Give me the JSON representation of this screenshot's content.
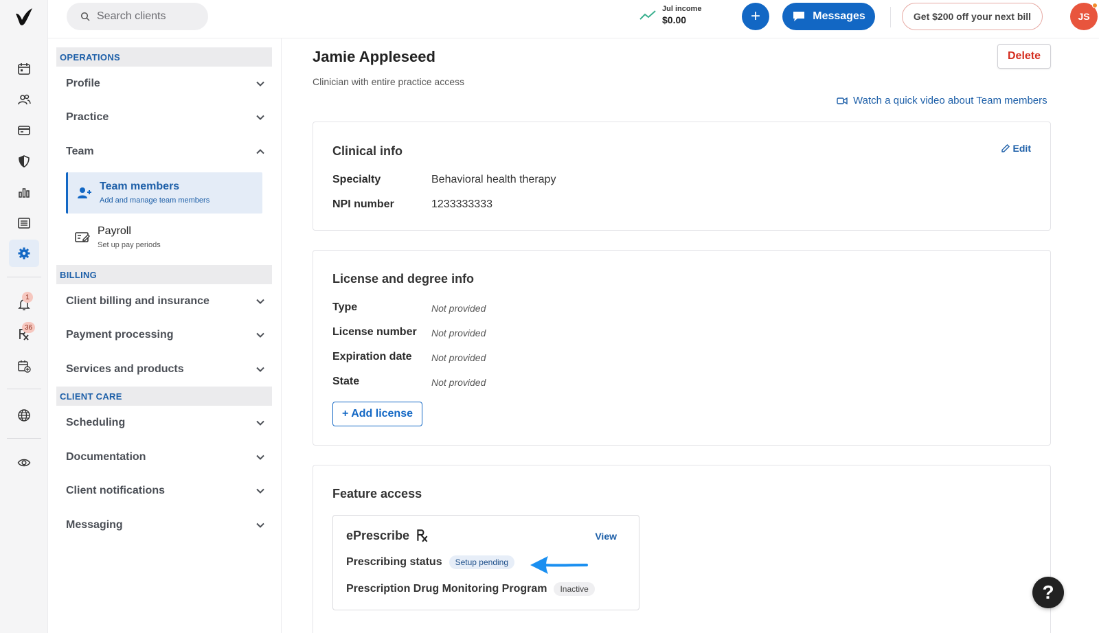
{
  "topbar": {
    "search_placeholder": "Search clients",
    "income_label": "Jul income",
    "income_value": "$0.00",
    "plus_label": "+",
    "messages_label": "Messages",
    "promo_label": "Get $200 off your next bill",
    "avatar_initials": "JS"
  },
  "rail": {
    "icons": [
      "logo",
      "calendar-icon",
      "clients-icon",
      "billing-card-icon",
      "insurance-shield-icon",
      "analytics-icon",
      "list-icon",
      "settings-gear-icon",
      "notifications-bell-icon",
      "prescription-icon",
      "calendar-add-icon",
      "globe-icon",
      "eye-icon"
    ],
    "notifications_badge": "1",
    "prescriptions_badge": "36",
    "accent": "#1267c4"
  },
  "sidebar": {
    "operations_header": "OPERATIONS",
    "profile": "Profile",
    "practice": "Practice",
    "team": "Team",
    "team_members": "Team members",
    "team_members_desc": "Add and manage team members",
    "payroll": "Payroll",
    "payroll_desc": "Set up pay periods",
    "billing_header": "BILLING",
    "client_billing": "Client billing and insurance",
    "payment_processing": "Payment processing",
    "services_products": "Services and products",
    "client_care_header": "CLIENT CARE",
    "scheduling": "Scheduling",
    "documentation": "Documentation",
    "client_notifications": "Client notifications",
    "messaging": "Messaging"
  },
  "main": {
    "title": "Jamie Appleseed",
    "subtitle": "Clinician with entire practice access",
    "delete_label": "Delete",
    "video_link": "Watch a quick video about Team members",
    "clinical": {
      "title": "Clinical info",
      "edit_label": "Edit",
      "specialty_label": "Specialty",
      "specialty_value": "Behavioral health therapy",
      "npi_label": "NPI number",
      "npi_value": "1233333333"
    },
    "license": {
      "title": "License and degree info",
      "type_label": "Type",
      "type_value": "Not provided",
      "number_label": "License number",
      "number_value": "Not provided",
      "expiration_label": "Expiration date",
      "expiration_value": "Not provided",
      "state_label": "State",
      "state_value": "Not provided",
      "add_label": "+ Add license"
    },
    "features": {
      "title": "Feature access",
      "eprescribe_title": "ePrescribe",
      "view_label": "View",
      "prescribing_status_label": "Prescribing status",
      "prescribing_status_value": "Setup pending",
      "pdmp_label": "Prescription Drug Monitoring Program",
      "pdmp_value": "Inactive"
    }
  },
  "help_label": "?"
}
